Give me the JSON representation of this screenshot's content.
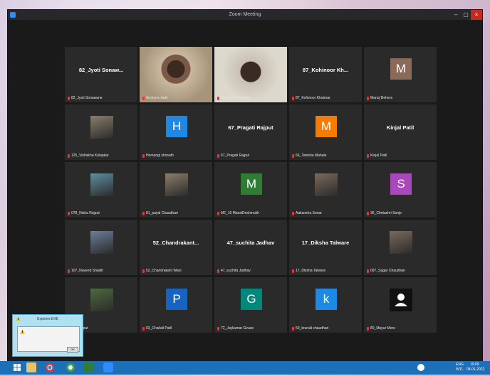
{
  "window": {
    "title": "Zoom Meeting",
    "minimize": "–",
    "maximize": "▢",
    "close": "×"
  },
  "participants": [
    {
      "kind": "name",
      "display": "82_Jyoti Sonaw...",
      "label": "82_Jyoti Sonawane"
    },
    {
      "kind": "video",
      "label": "Archana Jade"
    },
    {
      "kind": "video",
      "label": "Shirley Chowdhury",
      "active": true
    },
    {
      "kind": "name",
      "display": "87_Kohinoor Kh...",
      "label": "87_Kohinoor Khairnar"
    },
    {
      "kind": "avatar",
      "letter": "M",
      "color": "#8a6b5a",
      "label": "Manoj Behere"
    },
    {
      "kind": "photo",
      "label": "125_Vishakha Kolapkar"
    },
    {
      "kind": "avatar",
      "letter": "H",
      "color": "#1e88e5",
      "label": "Hemangi shirsath"
    },
    {
      "kind": "name",
      "display": "67_Pragati Rajput",
      "label": "67_Pragati Rajput"
    },
    {
      "kind": "avatar",
      "letter": "M",
      "color": "#f57c00",
      "label": "66_Tanisha Mahale"
    },
    {
      "kind": "name",
      "display": "Kinjal Patil",
      "label": "Kinjal Patil"
    },
    {
      "kind": "photo",
      "label": "078_Nisha Rajput"
    },
    {
      "kind": "photo",
      "label": "81_payal Chaudhari"
    },
    {
      "kind": "avatar",
      "letter": "M",
      "color": "#2e7d32",
      "label": "M2_16 MansiDeshmukh"
    },
    {
      "kind": "photo",
      "label": "Aakansha Sonar"
    },
    {
      "kind": "avatar",
      "letter": "S",
      "color": "#ab47bc",
      "label": "36_Chetashri Sonje"
    },
    {
      "kind": "photo",
      "label": "107_Naveed Shaikh"
    },
    {
      "kind": "name",
      "display": "52_Chandrakant...",
      "label": "52_Chandrakant Wani"
    },
    {
      "kind": "name",
      "display": "47_suchita Jadhav",
      "label": "47_suchita Jadhav"
    },
    {
      "kind": "name",
      "display": "17_Diksha Talware",
      "label": "17_Diksha Talware"
    },
    {
      "kind": "photo",
      "label": "097_Sagar Chaudhari"
    },
    {
      "kind": "photo",
      "label": "ldip Rajput"
    },
    {
      "kind": "avatar",
      "letter": "P",
      "color": "#1565c0",
      "label": "03_Chaitali Patil"
    },
    {
      "kind": "avatar",
      "letter": "G",
      "color": "#00897b",
      "label": "72_Jaykumar Girase"
    },
    {
      "kind": "avatar",
      "letter": "k",
      "color": "#1e88e5",
      "label": "50_krunali chaudhari"
    },
    {
      "kind": "person",
      "label": "80_Mayur More"
    }
  ],
  "explorer_dialog": {
    "title": "Explorer.EXE",
    "ok": "OK"
  },
  "taskbar": {
    "lang": "ENG",
    "region": "INTL",
    "time": "10:09",
    "date": "08-01-2022"
  },
  "colors": {
    "active_speaker": "#d9e84a",
    "muted_mic": "#ee3333",
    "taskbar": "#1d6fb8"
  }
}
